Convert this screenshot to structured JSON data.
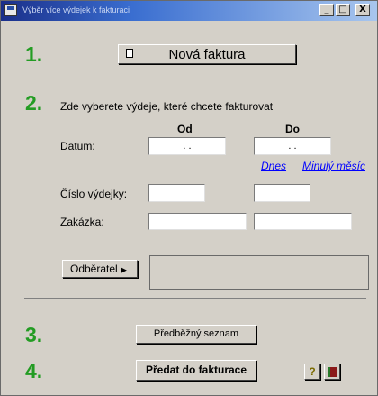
{
  "window": {
    "title": "Výběr více výdejek k fakturaci",
    "min_glyph": "_",
    "max_glyph": "□",
    "close_glyph": "X"
  },
  "steps": [
    "1.",
    "2.",
    "3.",
    "4."
  ],
  "new_invoice_button": {
    "label": "Nová faktura"
  },
  "instruction": "Zde vyberete výdeje, které chcete fakturovat",
  "columns": {
    "from": "Od",
    "to": "Do"
  },
  "fields": {
    "date_label": "Datum:",
    "date_from_value": ".   .",
    "date_to_value": ".   .",
    "voucher_label": "Číslo výdejky:",
    "order_label": "Zakázka:"
  },
  "links": {
    "today": "Dnes",
    "last_month": "Minulý měsíc"
  },
  "customer_button": {
    "label": "Odběratel",
    "arrow": "▶"
  },
  "preliminary_button": {
    "label": "Předběžný seznam"
  },
  "submit_button": {
    "label": "Předat do fakturace"
  },
  "icons": {
    "help": "help-icon",
    "exit": "exit-door-icon"
  },
  "colors": {
    "step_number": "#239c23",
    "link": "#0000ff",
    "window_face": "#d4d0c8"
  }
}
